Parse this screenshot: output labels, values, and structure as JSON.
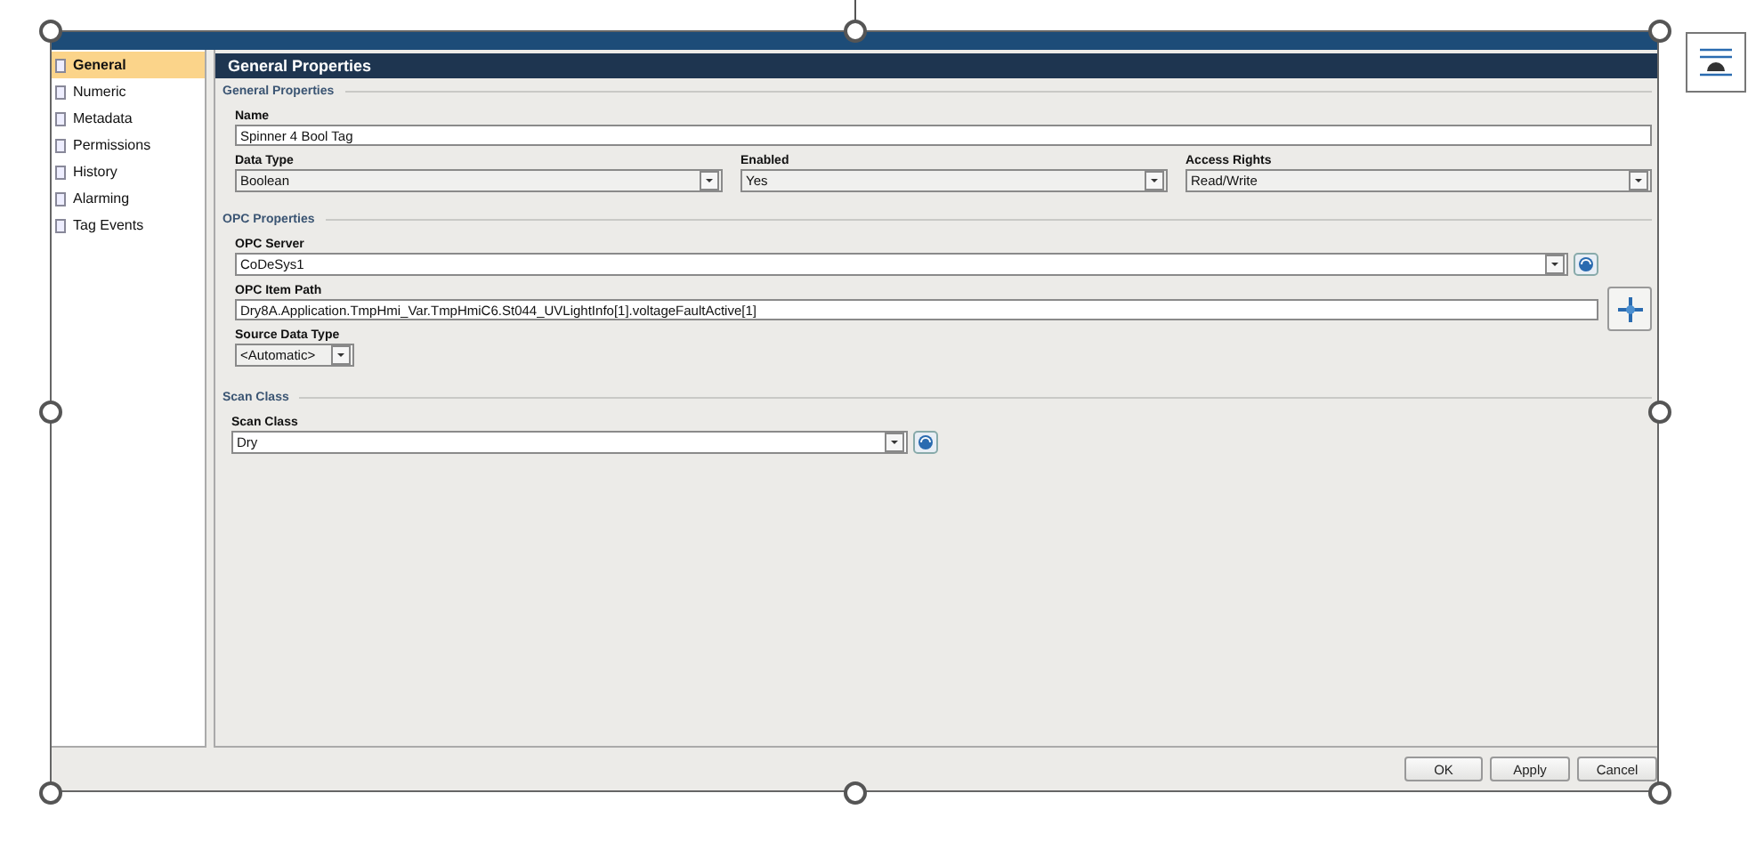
{
  "sidebar": {
    "items": [
      {
        "label": "General",
        "selected": true
      },
      {
        "label": "Numeric",
        "selected": false
      },
      {
        "label": "Metadata",
        "selected": false
      },
      {
        "label": "Permissions",
        "selected": false
      },
      {
        "label": "History",
        "selected": false
      },
      {
        "label": "Alarming",
        "selected": false
      },
      {
        "label": "Tag Events",
        "selected": false
      }
    ]
  },
  "panel": {
    "title": "General Properties"
  },
  "general": {
    "title": "General Properties",
    "name": {
      "label": "Name",
      "value": "Spinner 4 Bool Tag"
    },
    "data_type": {
      "label": "Data Type",
      "value": "Boolean"
    },
    "enabled": {
      "label": "Enabled",
      "value": "Yes"
    },
    "access_rights": {
      "label": "Access Rights",
      "value": "Read/Write"
    }
  },
  "opc": {
    "title": "OPC Properties",
    "server": {
      "label": "OPC Server",
      "value": "CoDeSys1"
    },
    "item_path": {
      "label": "OPC Item Path",
      "value": "Dry8A.Application.TmpHmi_Var.TmpHmiC6.St044_UVLightInfo[1].voltageFaultActive[1]"
    },
    "source_data_type": {
      "label": "Source Data Type",
      "value": "<Automatic>"
    }
  },
  "scan": {
    "title": "Scan Class",
    "scan_class": {
      "label": "Scan Class",
      "value": "Dry"
    }
  },
  "buttons": [
    {
      "label": "OK"
    },
    {
      "label": "Apply"
    },
    {
      "label": "Cancel"
    }
  ]
}
